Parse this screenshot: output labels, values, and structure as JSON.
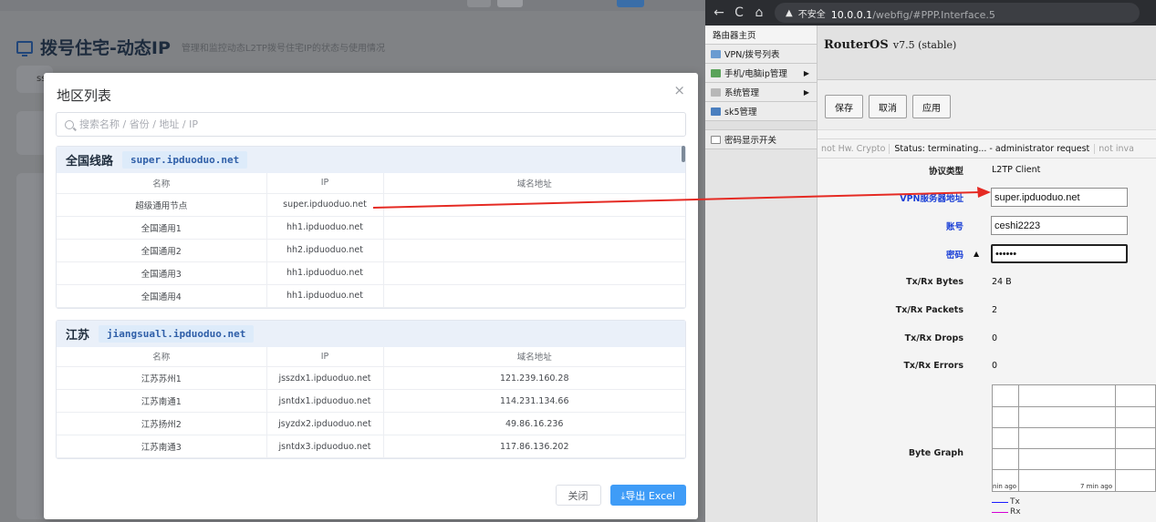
{
  "dashboard": {
    "title": "拨号住宅-动态IP",
    "subtitle": "管理和监控动态L2TP拨号住宅IP的状态与使用情况",
    "peek_text": "ss"
  },
  "modal": {
    "title": "地区列表",
    "close_glyph": "×",
    "search_placeholder": "搜索名称 / 省份 / 地址 / IP",
    "columns": {
      "name": "名称",
      "ip": "IP",
      "domain": "域名地址"
    },
    "regions": [
      {
        "name": "全国线路",
        "domain": "super.ipduoduo.net",
        "rows": [
          {
            "name": "超级通用节点",
            "ip": "super.ipduoduo.net",
            "domain": ""
          },
          {
            "name": "全国通用1",
            "ip": "hh1.ipduoduo.net",
            "domain": ""
          },
          {
            "name": "全国通用2",
            "ip": "hh2.ipduoduo.net",
            "domain": ""
          },
          {
            "name": "全国通用3",
            "ip": "hh1.ipduoduo.net",
            "domain": ""
          },
          {
            "name": "全国通用4",
            "ip": "hh1.ipduoduo.net",
            "domain": ""
          }
        ]
      },
      {
        "name": "江苏",
        "domain": "jiangsuall.ipduoduo.net",
        "rows": [
          {
            "name": "江苏苏州1",
            "ip": "jsszdx1.ipduoduo.net",
            "domain": "121.239.160.28"
          },
          {
            "name": "江苏南通1",
            "ip": "jsntdx1.ipduoduo.net",
            "domain": "114.231.134.66"
          },
          {
            "name": "江苏扬州2",
            "ip": "jsyzdx2.ipduoduo.net",
            "domain": "49.86.16.236"
          },
          {
            "name": "江苏南通3",
            "ip": "jsntdx3.ipduoduo.net",
            "domain": "117.86.136.202"
          }
        ]
      }
    ],
    "footer": {
      "close_label": "关闭",
      "export_label": "⤓导出 Excel"
    }
  },
  "browser": {
    "back": "←",
    "refresh": "C",
    "home": "⌂",
    "warning_glyph": "▲",
    "insecure": "不安全",
    "host": "10.0.0.1",
    "path": "/webfig/#PPP.Interface.5"
  },
  "sidebar": {
    "items": [
      {
        "label": "路由器主页",
        "icon": "none",
        "arrow": ""
      },
      {
        "label": "VPN/拨号列表",
        "icon": "vpn-icon",
        "arrow": ""
      },
      {
        "label": "手机/电脑ip管理",
        "icon": "network-icon",
        "arrow": "▶"
      },
      {
        "label": "系统管理",
        "icon": "system-icon",
        "arrow": "▶"
      },
      {
        "label": "sk5管理",
        "icon": "sk5-icon",
        "arrow": ""
      },
      {
        "label": "密码显示开关",
        "icon": "password-icon",
        "arrow": ""
      }
    ]
  },
  "routeros": {
    "brand": "RouterOS",
    "version": "v7.5 (stable)",
    "buttons": {
      "save": "保存",
      "cancel": "取消",
      "apply": "应用"
    },
    "status": {
      "hw_crypto": "not Hw. Crypto",
      "status": "Status: terminating... - administrator request",
      "invalid": "not inva"
    },
    "props": {
      "type_label": "协议类型",
      "type_value": "L2TP Client",
      "server_label": "VPN服务器地址",
      "server_value": "super.ipduoduo.net",
      "user_label": "账号",
      "user_value": "ceshi2223",
      "pass_label": "密码",
      "pass_value": "••••••",
      "pass_toggle": "▲",
      "bytes_label": "Tx/Rx Bytes",
      "bytes_value": "24 B",
      "packets_label": "Tx/Rx Packets",
      "packets_value": "2",
      "drops_label": "Tx/Rx Drops",
      "drops_value": "0",
      "errors_label": "Tx/Rx Errors",
      "errors_value": "0"
    },
    "graph": {
      "label": "Byte Graph",
      "tick_left": "nin ago",
      "tick_mid": "7 min ago",
      "legend": [
        {
          "name": "Tx",
          "color": "#1a1aff"
        },
        {
          "name": "Rx",
          "color": "#d400d4"
        }
      ]
    }
  },
  "annotation_color": "#e52a23"
}
